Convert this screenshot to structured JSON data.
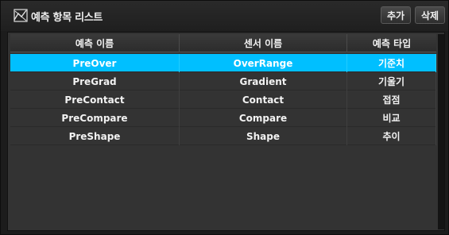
{
  "header": {
    "title": "예측 항목 리스트",
    "icon": "chart-icon",
    "add_label": "추가",
    "delete_label": "삭제"
  },
  "table": {
    "columns": [
      "예측 이름",
      "센서 이름",
      "예측 타입"
    ],
    "selected_index": 0,
    "selected_color": "#00bfff",
    "rows": [
      {
        "name": "PreOver",
        "sensor": "OverRange",
        "type": "기준치"
      },
      {
        "name": "PreGrad",
        "sensor": "Gradient",
        "type": "기울기"
      },
      {
        "name": "PreContact",
        "sensor": "Contact",
        "type": "접점"
      },
      {
        "name": "PreCompare",
        "sensor": "Compare",
        "type": "비교"
      },
      {
        "name": "PreShape",
        "sensor": "Shape",
        "type": "추이"
      }
    ]
  }
}
